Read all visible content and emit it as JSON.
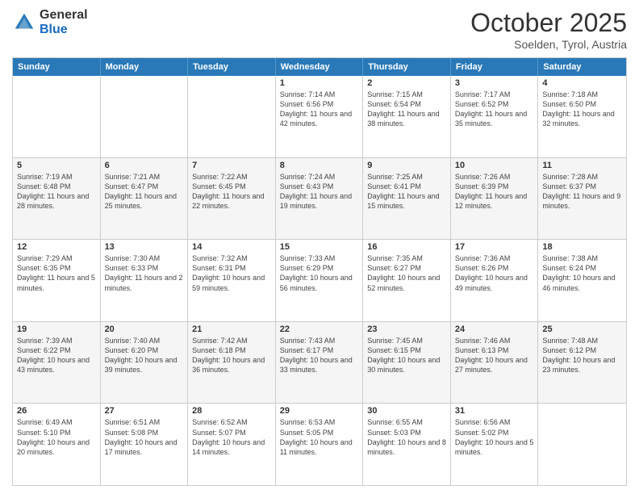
{
  "logo": {
    "general": "General",
    "blue": "Blue"
  },
  "title": {
    "month": "October 2025",
    "location": "Soelden, Tyrol, Austria"
  },
  "header_days": [
    "Sunday",
    "Monday",
    "Tuesday",
    "Wednesday",
    "Thursday",
    "Friday",
    "Saturday"
  ],
  "rows": [
    {
      "alt": false,
      "cells": [
        {
          "empty": true
        },
        {
          "empty": true
        },
        {
          "empty": true
        },
        {
          "day": "1",
          "info": "Sunrise: 7:14 AM\nSunset: 6:56 PM\nDaylight: 11 hours and 42 minutes."
        },
        {
          "day": "2",
          "info": "Sunrise: 7:15 AM\nSunset: 6:54 PM\nDaylight: 11 hours and 38 minutes."
        },
        {
          "day": "3",
          "info": "Sunrise: 7:17 AM\nSunset: 6:52 PM\nDaylight: 11 hours and 35 minutes."
        },
        {
          "day": "4",
          "info": "Sunrise: 7:18 AM\nSunset: 6:50 PM\nDaylight: 11 hours and 32 minutes."
        }
      ]
    },
    {
      "alt": true,
      "cells": [
        {
          "day": "5",
          "info": "Sunrise: 7:19 AM\nSunset: 6:48 PM\nDaylight: 11 hours and 28 minutes."
        },
        {
          "day": "6",
          "info": "Sunrise: 7:21 AM\nSunset: 6:47 PM\nDaylight: 11 hours and 25 minutes."
        },
        {
          "day": "7",
          "info": "Sunrise: 7:22 AM\nSunset: 6:45 PM\nDaylight: 11 hours and 22 minutes."
        },
        {
          "day": "8",
          "info": "Sunrise: 7:24 AM\nSunset: 6:43 PM\nDaylight: 11 hours and 19 minutes."
        },
        {
          "day": "9",
          "info": "Sunrise: 7:25 AM\nSunset: 6:41 PM\nDaylight: 11 hours and 15 minutes."
        },
        {
          "day": "10",
          "info": "Sunrise: 7:26 AM\nSunset: 6:39 PM\nDaylight: 11 hours and 12 minutes."
        },
        {
          "day": "11",
          "info": "Sunrise: 7:28 AM\nSunset: 6:37 PM\nDaylight: 11 hours and 9 minutes."
        }
      ]
    },
    {
      "alt": false,
      "cells": [
        {
          "day": "12",
          "info": "Sunrise: 7:29 AM\nSunset: 6:35 PM\nDaylight: 11 hours and 5 minutes."
        },
        {
          "day": "13",
          "info": "Sunrise: 7:30 AM\nSunset: 6:33 PM\nDaylight: 11 hours and 2 minutes."
        },
        {
          "day": "14",
          "info": "Sunrise: 7:32 AM\nSunset: 6:31 PM\nDaylight: 10 hours and 59 minutes."
        },
        {
          "day": "15",
          "info": "Sunrise: 7:33 AM\nSunset: 6:29 PM\nDaylight: 10 hours and 56 minutes."
        },
        {
          "day": "16",
          "info": "Sunrise: 7:35 AM\nSunset: 6:27 PM\nDaylight: 10 hours and 52 minutes."
        },
        {
          "day": "17",
          "info": "Sunrise: 7:36 AM\nSunset: 6:26 PM\nDaylight: 10 hours and 49 minutes."
        },
        {
          "day": "18",
          "info": "Sunrise: 7:38 AM\nSunset: 6:24 PM\nDaylight: 10 hours and 46 minutes."
        }
      ]
    },
    {
      "alt": true,
      "cells": [
        {
          "day": "19",
          "info": "Sunrise: 7:39 AM\nSunset: 6:22 PM\nDaylight: 10 hours and 43 minutes."
        },
        {
          "day": "20",
          "info": "Sunrise: 7:40 AM\nSunset: 6:20 PM\nDaylight: 10 hours and 39 minutes."
        },
        {
          "day": "21",
          "info": "Sunrise: 7:42 AM\nSunset: 6:18 PM\nDaylight: 10 hours and 36 minutes."
        },
        {
          "day": "22",
          "info": "Sunrise: 7:43 AM\nSunset: 6:17 PM\nDaylight: 10 hours and 33 minutes."
        },
        {
          "day": "23",
          "info": "Sunrise: 7:45 AM\nSunset: 6:15 PM\nDaylight: 10 hours and 30 minutes."
        },
        {
          "day": "24",
          "info": "Sunrise: 7:46 AM\nSunset: 6:13 PM\nDaylight: 10 hours and 27 minutes."
        },
        {
          "day": "25",
          "info": "Sunrise: 7:48 AM\nSunset: 6:12 PM\nDaylight: 10 hours and 23 minutes."
        }
      ]
    },
    {
      "alt": false,
      "cells": [
        {
          "day": "26",
          "info": "Sunrise: 6:49 AM\nSunset: 5:10 PM\nDaylight: 10 hours and 20 minutes."
        },
        {
          "day": "27",
          "info": "Sunrise: 6:51 AM\nSunset: 5:08 PM\nDaylight: 10 hours and 17 minutes."
        },
        {
          "day": "28",
          "info": "Sunrise: 6:52 AM\nSunset: 5:07 PM\nDaylight: 10 hours and 14 minutes."
        },
        {
          "day": "29",
          "info": "Sunrise: 6:53 AM\nSunset: 5:05 PM\nDaylight: 10 hours and 11 minutes."
        },
        {
          "day": "30",
          "info": "Sunrise: 6:55 AM\nSunset: 5:03 PM\nDaylight: 10 hours and 8 minutes."
        },
        {
          "day": "31",
          "info": "Sunrise: 6:56 AM\nSunset: 5:02 PM\nDaylight: 10 hours and 5 minutes."
        },
        {
          "empty": true
        }
      ]
    }
  ]
}
